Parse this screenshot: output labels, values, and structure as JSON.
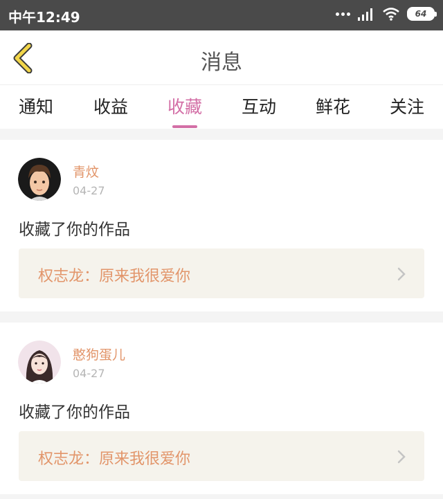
{
  "status": {
    "time": "中午12:49",
    "battery": "64"
  },
  "header": {
    "title": "消息"
  },
  "tabs": [
    {
      "label": "通知"
    },
    {
      "label": "收益"
    },
    {
      "label": "收藏",
      "active": true
    },
    {
      "label": "互动"
    },
    {
      "label": "鲜花"
    },
    {
      "label": "关注"
    }
  ],
  "messages": [
    {
      "name": "青炆",
      "date": "04-27",
      "action": "收藏了你的作品",
      "work": "权志龙：原来我很爱你"
    },
    {
      "name": "憨狗蛋儿",
      "date": "04-27",
      "action": "收藏了你的作品",
      "work": "权志龙：原来我很爱你"
    }
  ],
  "colors": {
    "accent": "#d36fa6",
    "name": "#e2956a",
    "back": "#f2d64a"
  },
  "icons": {
    "back": "chevron-left-icon",
    "more": "chevron-right-icon",
    "signal": "signal-icon",
    "wifi": "wifi-icon"
  }
}
